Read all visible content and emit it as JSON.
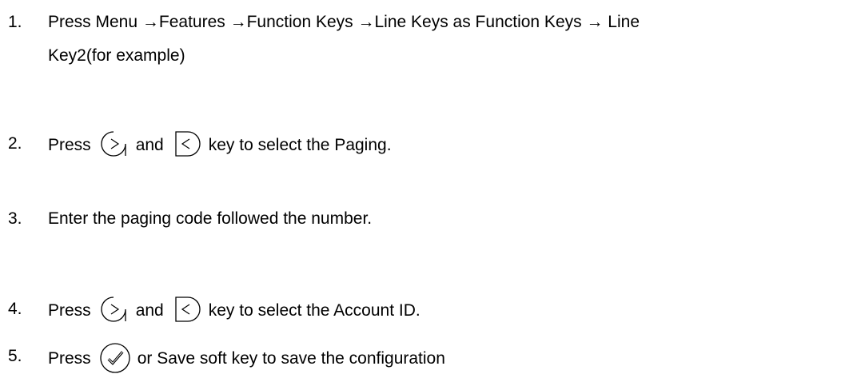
{
  "steps": [
    {
      "number": "1.",
      "line1": "Press Menu →Features →Function Keys →Line Keys as Function Keys → Line",
      "line2": "Key2(for example)"
    },
    {
      "number": "2.",
      "before": "Press",
      "middle": "and",
      "after": "key to select the Paging.",
      "keys": [
        "right-arrow-key",
        "left-arrow-key"
      ]
    },
    {
      "number": "3.",
      "text": "Enter the paging code followed the number."
    },
    {
      "number": "4.",
      "before": "Press",
      "middle": "and",
      "after": "key to select the Account ID.",
      "keys": [
        "right-arrow-key",
        "left-arrow-key"
      ]
    },
    {
      "number": "5.",
      "before": "Press",
      "after": "or Save soft key to save the configuration",
      "keys": [
        "ok-check-key"
      ]
    }
  ]
}
